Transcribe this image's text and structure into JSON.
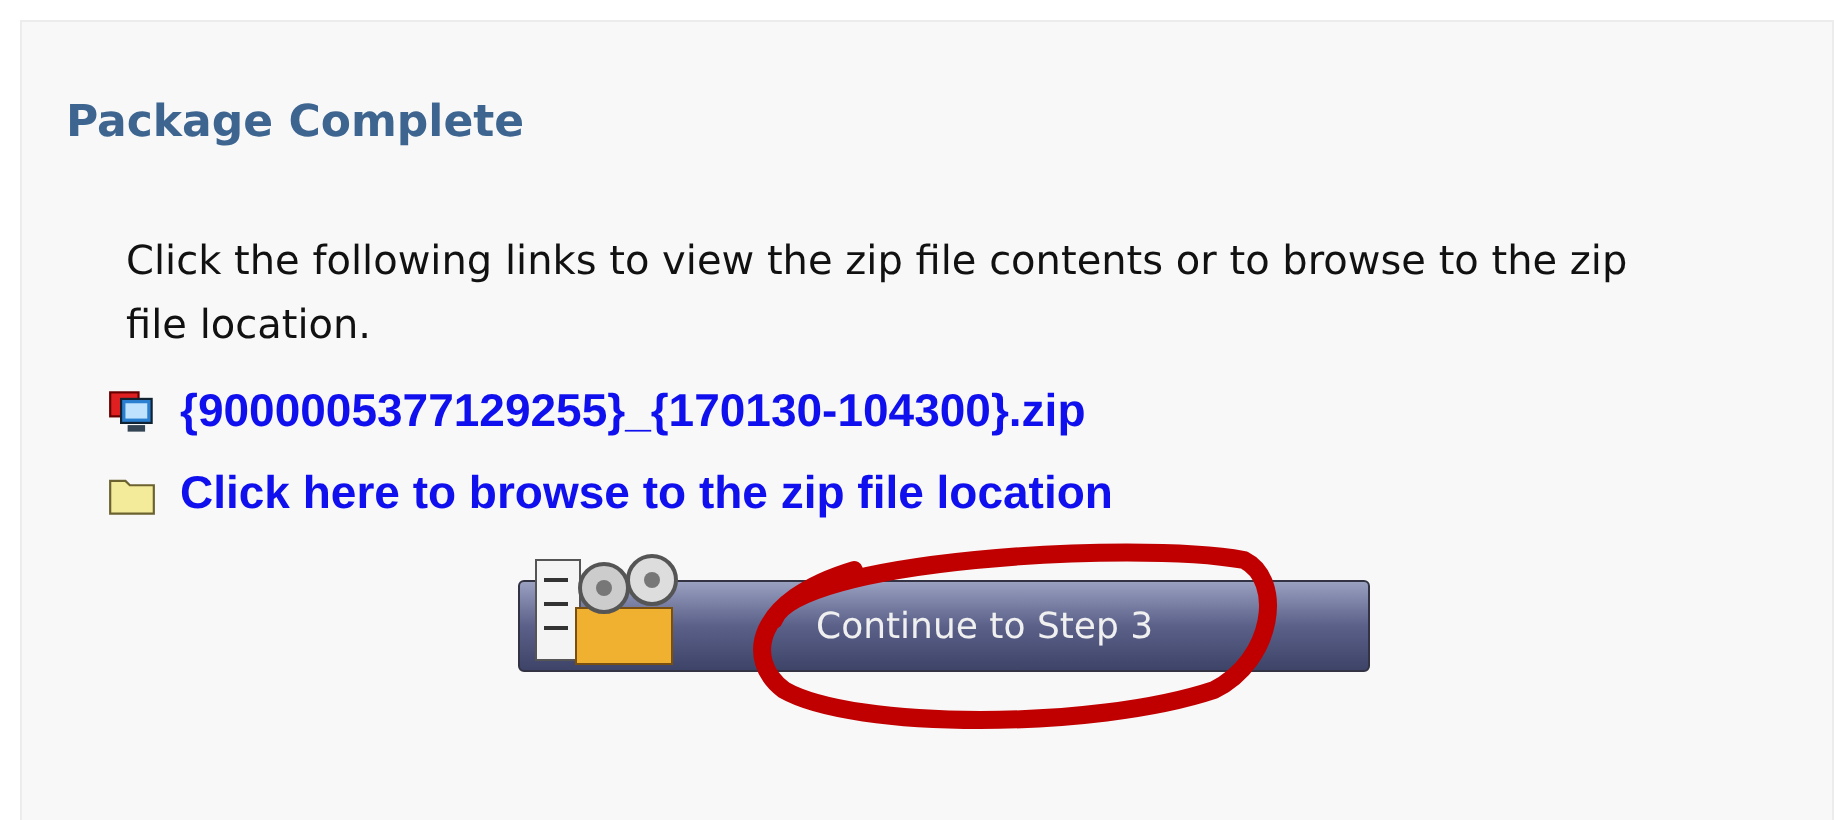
{
  "panel": {
    "title": "Package Complete",
    "description": "Click the following links to view the zip file contents or to browse to the zip file location.",
    "links": [
      {
        "kind": "file",
        "label": "{9000005377129255}_{170130-104300}.zip"
      },
      {
        "kind": "folder",
        "label": "Click here to browse to the zip file location"
      }
    ],
    "button": {
      "label": "Continue to Step 3"
    }
  }
}
